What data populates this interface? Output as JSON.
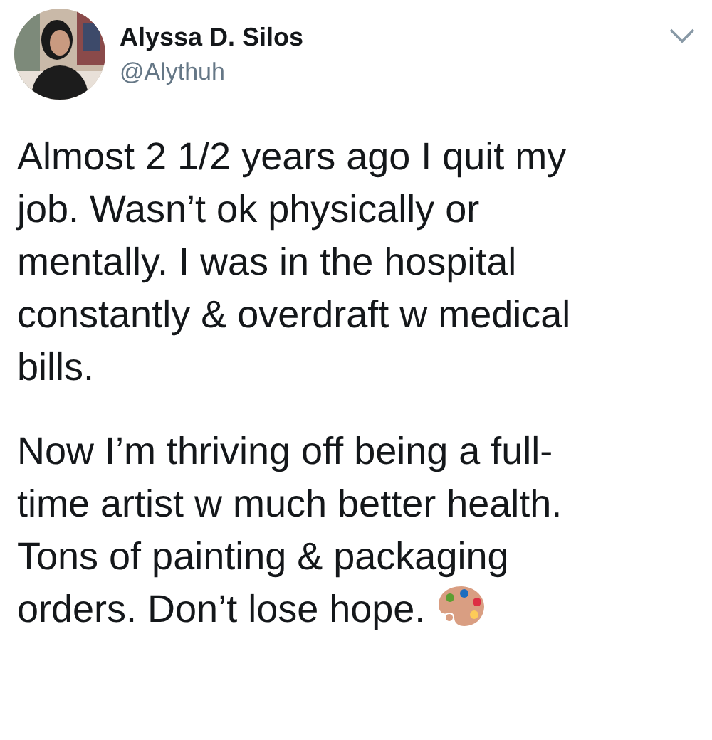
{
  "author": {
    "name": "Alyssa D. Silos",
    "handle": "@Alythuh"
  },
  "paragraphs": [
    {
      "lines": [
        "Almost 2 1/2 years ago I quit my",
        "job. Wasn’t ok physically or",
        "mentally. I was in the hospital",
        "constantly & overdraft w medical",
        "bills."
      ]
    },
    {
      "lines": [
        "Now I’m thriving off being a full-",
        "time artist w much better health.",
        "Tons of painting & packaging",
        "orders. Don’t lose hope."
      ],
      "palette_icon": true
    }
  ]
}
